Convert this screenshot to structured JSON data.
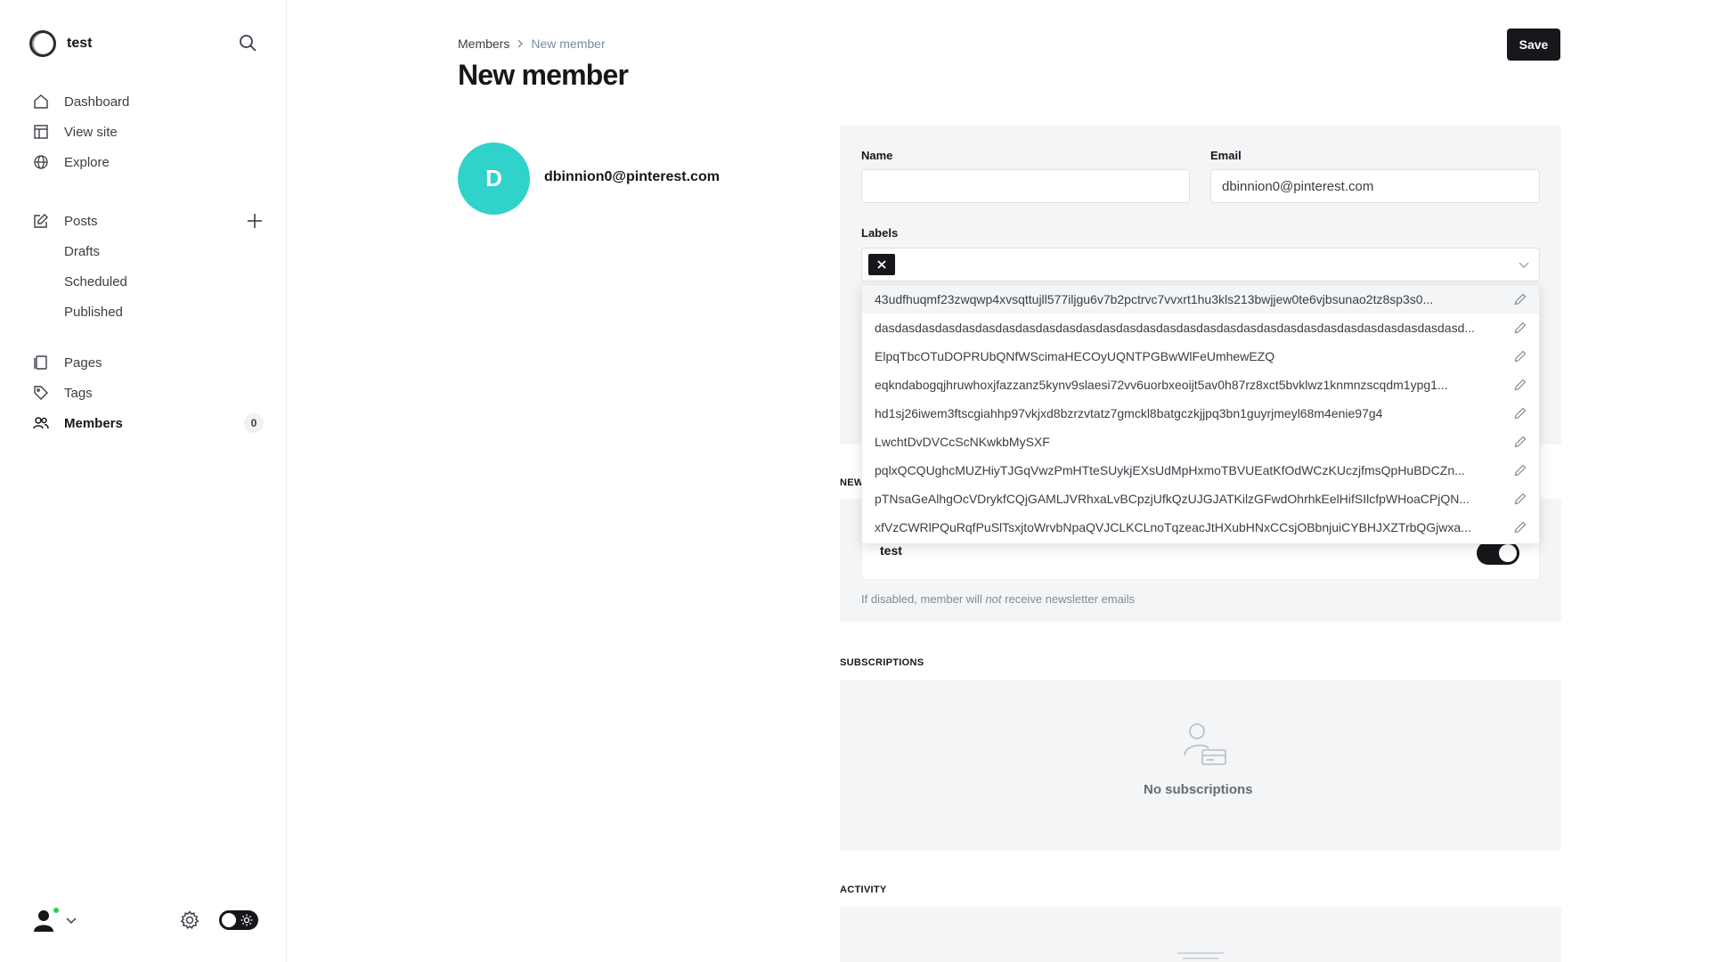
{
  "sidebar": {
    "site_name": "test",
    "nav_primary": [
      {
        "label": "Dashboard",
        "icon": "home-icon"
      },
      {
        "label": "View site",
        "icon": "layout-icon"
      },
      {
        "label": "Explore",
        "icon": "globe-icon"
      }
    ],
    "posts": {
      "label": "Posts",
      "sub": [
        "Drafts",
        "Scheduled",
        "Published"
      ]
    },
    "nav_secondary": [
      {
        "label": "Pages",
        "icon": "page-icon"
      },
      {
        "label": "Tags",
        "icon": "tag-icon"
      },
      {
        "label": "Members",
        "icon": "members-icon",
        "count": "0"
      }
    ]
  },
  "header": {
    "breadcrumb_parent": "Members",
    "breadcrumb_current": "New member",
    "title": "New member",
    "save_label": "Save"
  },
  "member": {
    "initial": "D",
    "email": "dbinnion0@pinterest.com",
    "avatar_color": "#30d2ca"
  },
  "form": {
    "name_label": "Name",
    "name_value": "",
    "email_label": "Email",
    "email_value": "dbinnion0@pinterest.com",
    "labels_label": "Labels"
  },
  "label_options": [
    "43udfhuqmf23zwqwp4xvsqttujll577iljgu6v7b2pctrvc7vvxrt1hu3kls213bwjjew0te6vjbsunao2tz8sp3s0...",
    "dasdasdasdasdasdasdasdasdasdasdasdasdasdasdasdasdasdasdasdasdasdasdasdasdasdasdasdasdasd...",
    "ElpqTbcOTuDOPRUbQNfWScimaHECOyUQNTPGBwWlFeUmhewEZQ",
    "eqkndabogqjhruwhoxjfazzanz5kynv9slaesi72vv6uorbxeoijt5av0h87rz8xct5bvklwz1knmnzscqdm1ypg1...",
    "hd1sj26iwem3ftscgiahhp97vkjxd8bzrzvtatz7gmckl8batgczkjjpq3bn1guyrjmeyl68m4enie97g4",
    "LwchtDvDVCcScNKwkbMySXF",
    "pqlxQCQUghcMUZHiyTJGqVwzPmHTteSUykjEXsUdMpHxmoTBVUEatKfOdWCzKUczjfmsQpHuBDCZn...",
    "pTNsaGeAlhgOcVDrykfCQjGAMLJVRhxaLvBCpzjUfkQzUJGJATKilzGFwdOhrhkEelHifSIlcfpWHoaCPjQN...",
    "xfVzCWRlPQuRqfPuSlTsxjtoWrvbNpaQVJCLKCLnoTqzeacJtHXubHNxCCsjOBbnjuiCYBHJXZTrbQGjwxa..."
  ],
  "newsletters": {
    "section_title": "NEW",
    "item_name": "test",
    "enabled": true,
    "hint_prefix": "If disabled, member will ",
    "hint_emphasis": "not",
    "hint_suffix": " receive newsletter emails"
  },
  "subscriptions": {
    "section_title": "SUBSCRIPTIONS",
    "empty_label": "No subscriptions"
  },
  "activity": {
    "section_title": "ACTIVITY"
  }
}
